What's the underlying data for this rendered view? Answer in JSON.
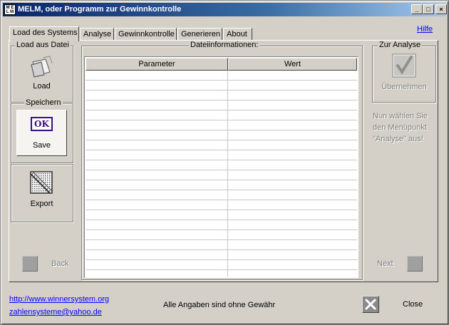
{
  "window": {
    "title": "MELM, oder Programm zur Gewinnkontrolle",
    "icon_lines": [
      "M E",
      "L M"
    ],
    "buttons": {
      "minimize": "_",
      "maximize": "□",
      "close": "×"
    }
  },
  "tabs": [
    {
      "label": "Load des Systems",
      "active": true
    },
    {
      "label": "Analyse",
      "active": false
    },
    {
      "label": "Gewinnkontrolle",
      "active": false
    },
    {
      "label": "Generieren",
      "active": false
    },
    {
      "label": "About",
      "active": false
    }
  ],
  "help_link": "Hilfe",
  "left_panel": {
    "load_group": "Load aus Datei",
    "load_button": "Load",
    "save_group": "Speichern",
    "save_icon_text": "OK",
    "save_button": "Save",
    "export_button": "Export"
  },
  "file_info": {
    "group_label": "Dateiinformationen:",
    "columns": [
      "Parameter",
      "Wert"
    ]
  },
  "right_panel": {
    "group_label": "Zur Analyse",
    "apply_button": "Übernehmen",
    "hint": "Nun wählen Sie den Menüpunkt \"Analyse\" aus!"
  },
  "navigation": {
    "back": "Back",
    "next": "Next"
  },
  "footer": {
    "website": "http://www.winnersystem.org",
    "email": "zahlensysteme@yahoo.de",
    "disclaimer": "Alle Angaben sind ohne Gewähr",
    "close": "Close"
  },
  "colors": {
    "face": "#d4d0c8",
    "title_start": "#0a246a",
    "title_end": "#a6caf0",
    "link": "#0000ff",
    "disabled": "#808080"
  },
  "icons": {
    "app": "melm-app-icon",
    "load": "open-file-icon",
    "save": "ok-icon",
    "export": "export-grid-icon",
    "apply": "checkmark-icon",
    "close": "close-x-icon"
  }
}
